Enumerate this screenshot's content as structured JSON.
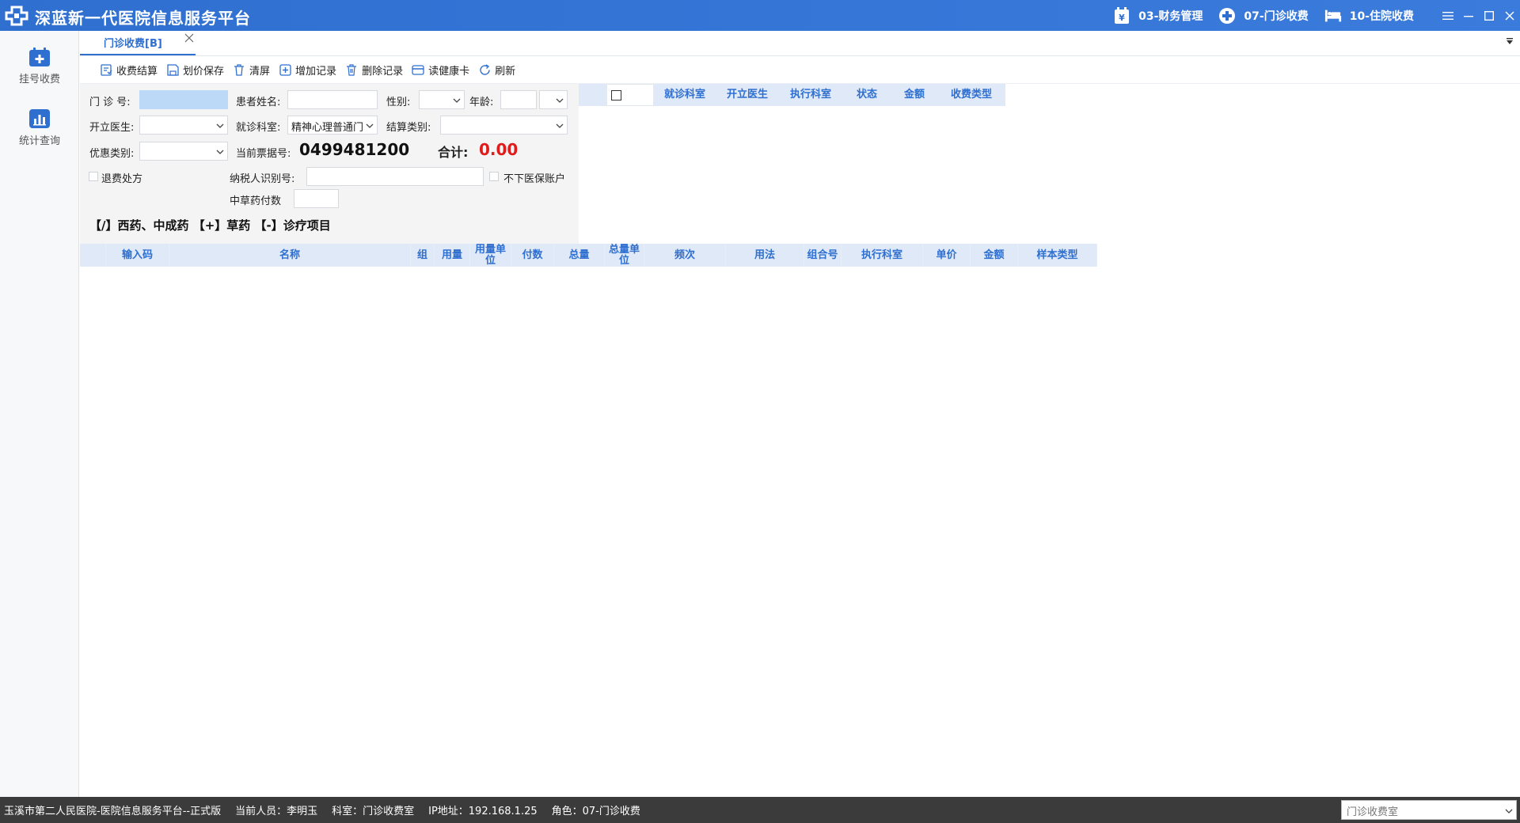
{
  "titlebar": {
    "app_title": "深蓝新一代医院信息服务平台",
    "logo_icon": "hospital-cross-logo-icon",
    "modules": [
      {
        "label": "03-财务管理",
        "icon": "finance-icon"
      },
      {
        "label": "07-门诊收费",
        "icon": "medical-cross-icon"
      },
      {
        "label": "10-住院收费",
        "icon": "bed-icon"
      }
    ]
  },
  "leftnav": {
    "items": [
      {
        "label": "挂号收费",
        "icon": "calendar-plus-icon"
      },
      {
        "label": "统计查询",
        "icon": "bar-chart-icon"
      }
    ]
  },
  "tabs": [
    {
      "label": "门诊收费[B]",
      "active": true
    }
  ],
  "toolbar": {
    "buttons": [
      {
        "label": "收费结算",
        "icon": "settle-icon"
      },
      {
        "label": "划价保存",
        "icon": "save-icon"
      },
      {
        "label": "清屏",
        "icon": "clear-icon"
      },
      {
        "label": "增加记录",
        "icon": "add-icon"
      },
      {
        "label": "删除记录",
        "icon": "delete-icon"
      },
      {
        "label": "读健康卡",
        "icon": "card-icon"
      },
      {
        "label": "刷新",
        "icon": "refresh-icon"
      }
    ]
  },
  "form": {
    "clinic_no_label": "门  诊  号:",
    "clinic_no_value": "",
    "patient_name_label": "患者姓名:",
    "patient_name_value": "",
    "gender_label": "性别:",
    "gender_value": "",
    "age_label": "年龄:",
    "age_value": "",
    "age_unit_value": "",
    "doctor_label": "开立医生:",
    "doctor_value": "",
    "dept_label": "就诊科室:",
    "dept_value": "精神心理普通门",
    "settle_type_label": "结算类别:",
    "settle_type_value": "",
    "discount_label": "优惠类别:",
    "discount_value": "",
    "receipt_label": "当前票据号:",
    "receipt_value": "0499481200",
    "total_label": "合计:",
    "total_value": "0.00",
    "refund_label": "退费处方",
    "taxpayer_label": "纳税人识别号:",
    "taxpayer_value": "",
    "no_insurance_label": "不下医保账户",
    "herbal_label": "中草药付数",
    "herbal_value": "",
    "hint": "【/】西药、中成药 【+】草药 【-】诊疗项目"
  },
  "summary_table": {
    "headers": [
      "就诊科室",
      "开立医生",
      "执行科室",
      "状态",
      "金额",
      "收费类型"
    ]
  },
  "item_table": {
    "headers": [
      "输入码",
      "名称",
      "组",
      "用量",
      "用量单位",
      "付数",
      "总量",
      "总量单位",
      "频次",
      "用法",
      "组合号",
      "执行科室",
      "单价",
      "金额",
      "样本类型"
    ]
  },
  "statusbar": {
    "items": [
      "玉溪市第二人民医院-医院信息服务平台--正式版",
      "当前人员：李明玉",
      "科室：门诊收费室",
      "IP地址：192.168.1.25",
      "角色：07-门诊收费"
    ],
    "room_select": "门诊收费室"
  },
  "colors": {
    "titlebar": "#2f6fd0",
    "header_text": "#2f6fd0",
    "total": "#e01b1b"
  }
}
